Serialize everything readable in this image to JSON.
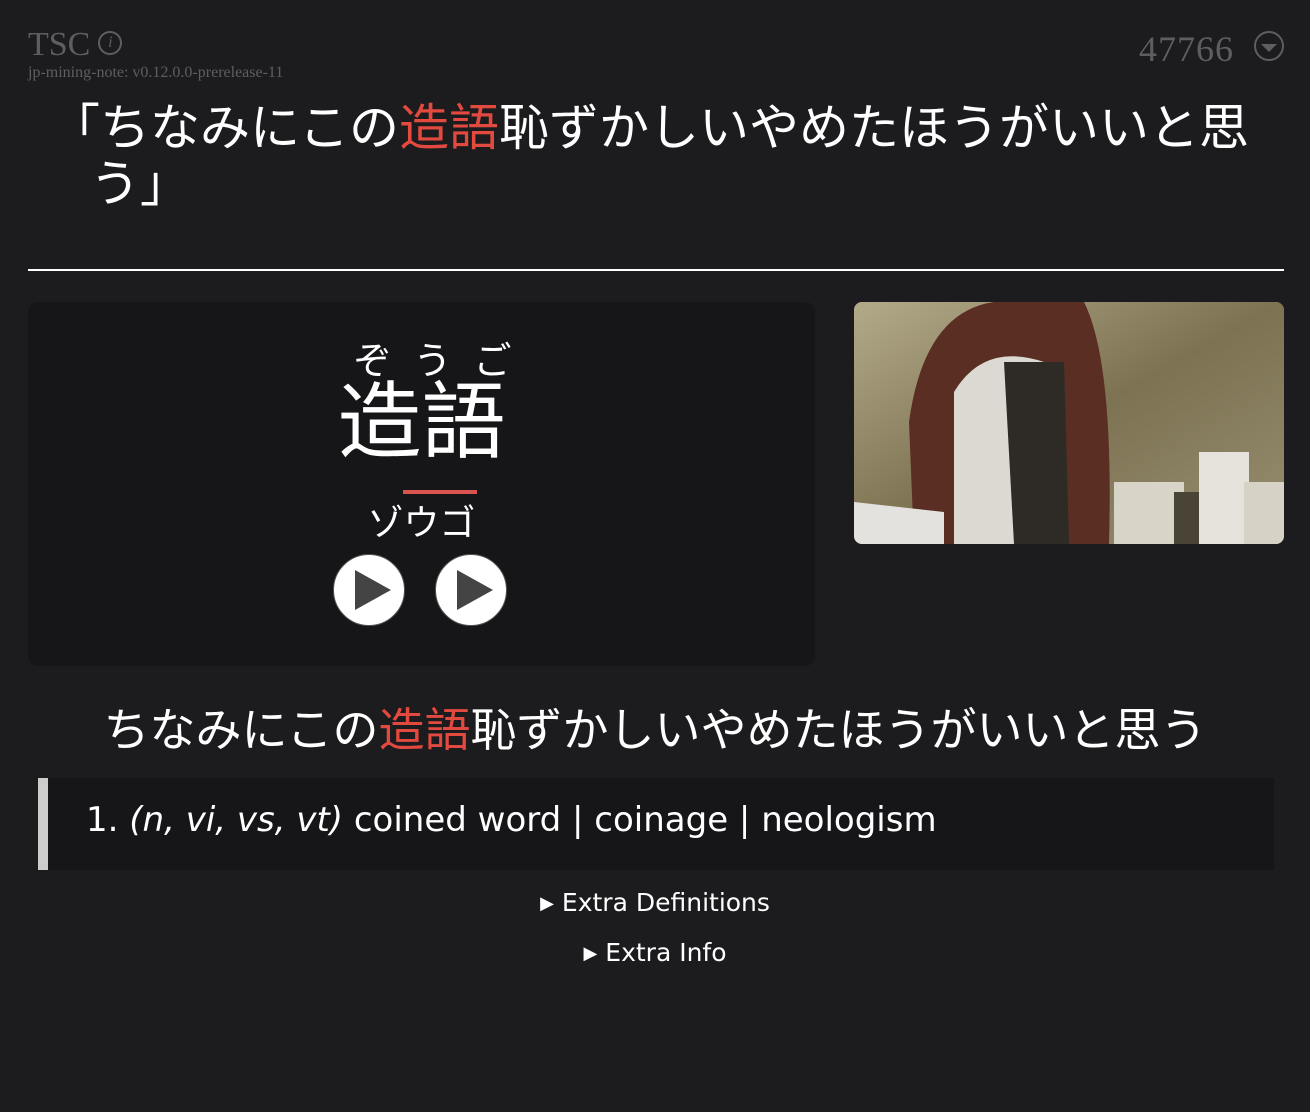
{
  "header": {
    "card_type": "TSC",
    "info_icon": "info-icon",
    "version": "jp-mining-note: v0.12.0.0-prerelease-11",
    "card_id": "47766",
    "toggle_icon": "chevron-down-circle-icon"
  },
  "full_sentence": {
    "open_quote": "「",
    "before": "ちなみにこの",
    "highlight": "造語",
    "after": "恥ずかしいやめたほうがいいと思う",
    "close_quote": "」"
  },
  "word": {
    "reading": "ぞうご",
    "expression": "造語",
    "katakana": "ゾウゴ",
    "pitch_accent": "heiban",
    "audio_buttons": [
      "word-audio",
      "sentence-audio"
    ]
  },
  "picture": {
    "alt": "anime-screenshot"
  },
  "sentence": {
    "before": "ちなみにこの",
    "highlight": "造語",
    "after": "恥ずかしいやめたほうがいいと思う"
  },
  "definition": {
    "number": "1.",
    "tags": "(n, vi, vs, vt)",
    "glosses": "coined word | coinage | neologism"
  },
  "collapsibles": [
    {
      "label": "Extra Definitions",
      "open": false
    },
    {
      "label": "Extra Info",
      "open": false
    }
  ],
  "colors": {
    "background": "#1c1c1e",
    "panel": "#161618",
    "highlight": "#e2493f",
    "muted": "#5e5e62"
  }
}
